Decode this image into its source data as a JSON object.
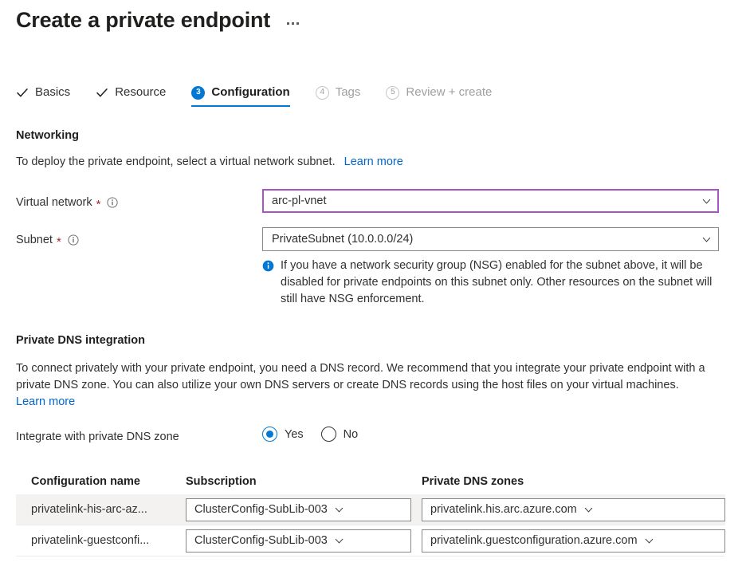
{
  "header": {
    "title": "Create a private endpoint",
    "more_label": "..."
  },
  "wizard": {
    "tabs": [
      {
        "label": "Basics",
        "state": "done",
        "marker": "check"
      },
      {
        "label": "Resource",
        "state": "done",
        "marker": "check"
      },
      {
        "label": "Configuration",
        "state": "active",
        "marker": "3"
      },
      {
        "label": "Tags",
        "state": "upcoming",
        "marker": "4"
      },
      {
        "label": "Review + create",
        "state": "upcoming",
        "marker": "5"
      }
    ]
  },
  "networking": {
    "heading": "Networking",
    "description": "To deploy the private endpoint, select a virtual network subnet.",
    "learn_more": "Learn more",
    "virtual_network": {
      "label": "Virtual network",
      "required_mark": "*",
      "value": "arc-pl-vnet"
    },
    "subnet": {
      "label": "Subnet",
      "required_mark": "*",
      "value": "PrivateSubnet (10.0.0.0/24)"
    },
    "nsg_notice": "If you have a network security group (NSG) enabled for the subnet above, it will be disabled for private endpoints on this subnet only. Other resources on the subnet will still have NSG enforcement."
  },
  "dns": {
    "heading": "Private DNS integration",
    "description": "To connect privately with your private endpoint, you need a DNS record. We recommend that you integrate your private endpoint with a private DNS zone. You can also utilize your own DNS servers or create DNS records using the host files on your virtual machines.",
    "learn_more": "Learn more",
    "integrate_label": "Integrate with private DNS zone",
    "options": [
      {
        "label": "Yes",
        "selected": true
      },
      {
        "label": "No",
        "selected": false
      }
    ],
    "table": {
      "columns": [
        "Configuration name",
        "Subscription",
        "Private DNS zones"
      ],
      "rows": [
        {
          "name": "privatelink-his-arc-az...",
          "subscription": "ClusterConfig-SubLib-003",
          "zone": "privatelink.his.arc.azure.com"
        },
        {
          "name": "privatelink-guestconfi...",
          "subscription": "ClusterConfig-SubLib-003",
          "zone": "privatelink.guestconfiguration.azure.com"
        }
      ]
    }
  },
  "colors": {
    "accent": "#0078d4",
    "link": "#0066cc",
    "required": "#a4262c",
    "focus_border": "#a855c8",
    "row_alt": "#f3f2f1"
  }
}
